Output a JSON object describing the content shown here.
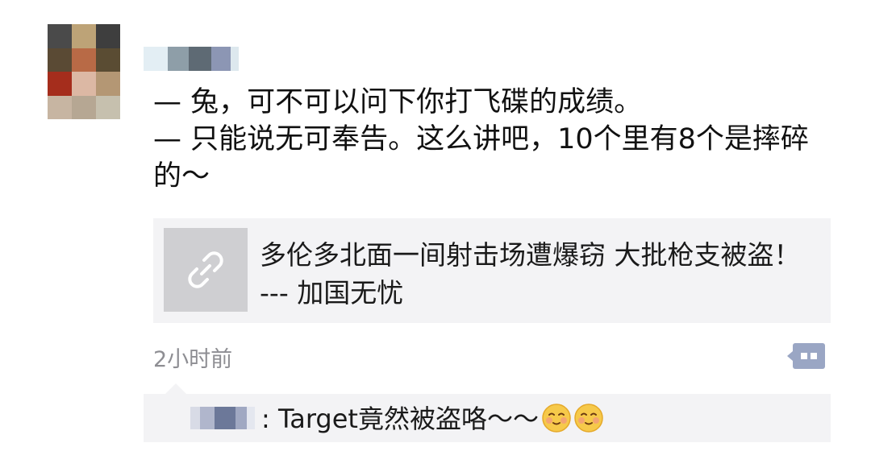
{
  "post": {
    "line1": "— 兔，可不可以问下你打飞碟的成绩。",
    "line2": "— 只能说无可奉告。这么讲吧，10个里有8个是摔碎的～"
  },
  "link": {
    "title": "多伦多北面一间射击场遭爆窃 大批枪支被盗！ --- 加国无忧",
    "icon": "link-icon"
  },
  "meta": {
    "timestamp": "2小时前",
    "comment_icon": "comment-icon"
  },
  "comment": {
    "text": ": Target竟然被盗咯～～",
    "emoji": "smiling-face-emoji"
  },
  "colors": {
    "card_bg": "#f3f3f5",
    "thumb_bg": "#cfcfd2",
    "accent_blue": "#9aa6c4",
    "muted_text": "#8e8e93"
  }
}
